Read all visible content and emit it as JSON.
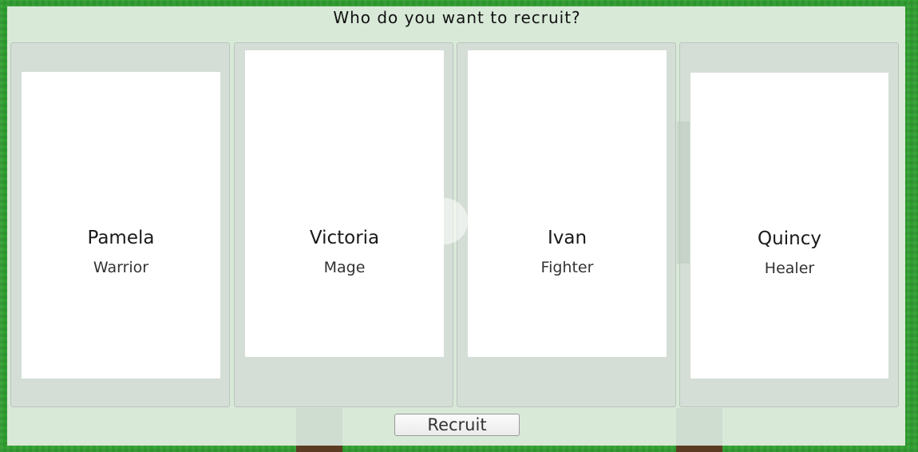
{
  "dialog": {
    "title": "Who do you want to recruit?",
    "recruit_label": "Recruit"
  },
  "candidates": [
    {
      "name": "Pamela",
      "class": "Warrior"
    },
    {
      "name": "Victoria",
      "class": "Mage"
    },
    {
      "name": "Ivan",
      "class": "Fighter"
    },
    {
      "name": "Quincy",
      "class": "Healer"
    }
  ],
  "colors": {
    "background_grass": "#2f9e2f",
    "panel": "#d8e9d8",
    "slot": "#d4ddd6",
    "card": "#ffffff"
  }
}
